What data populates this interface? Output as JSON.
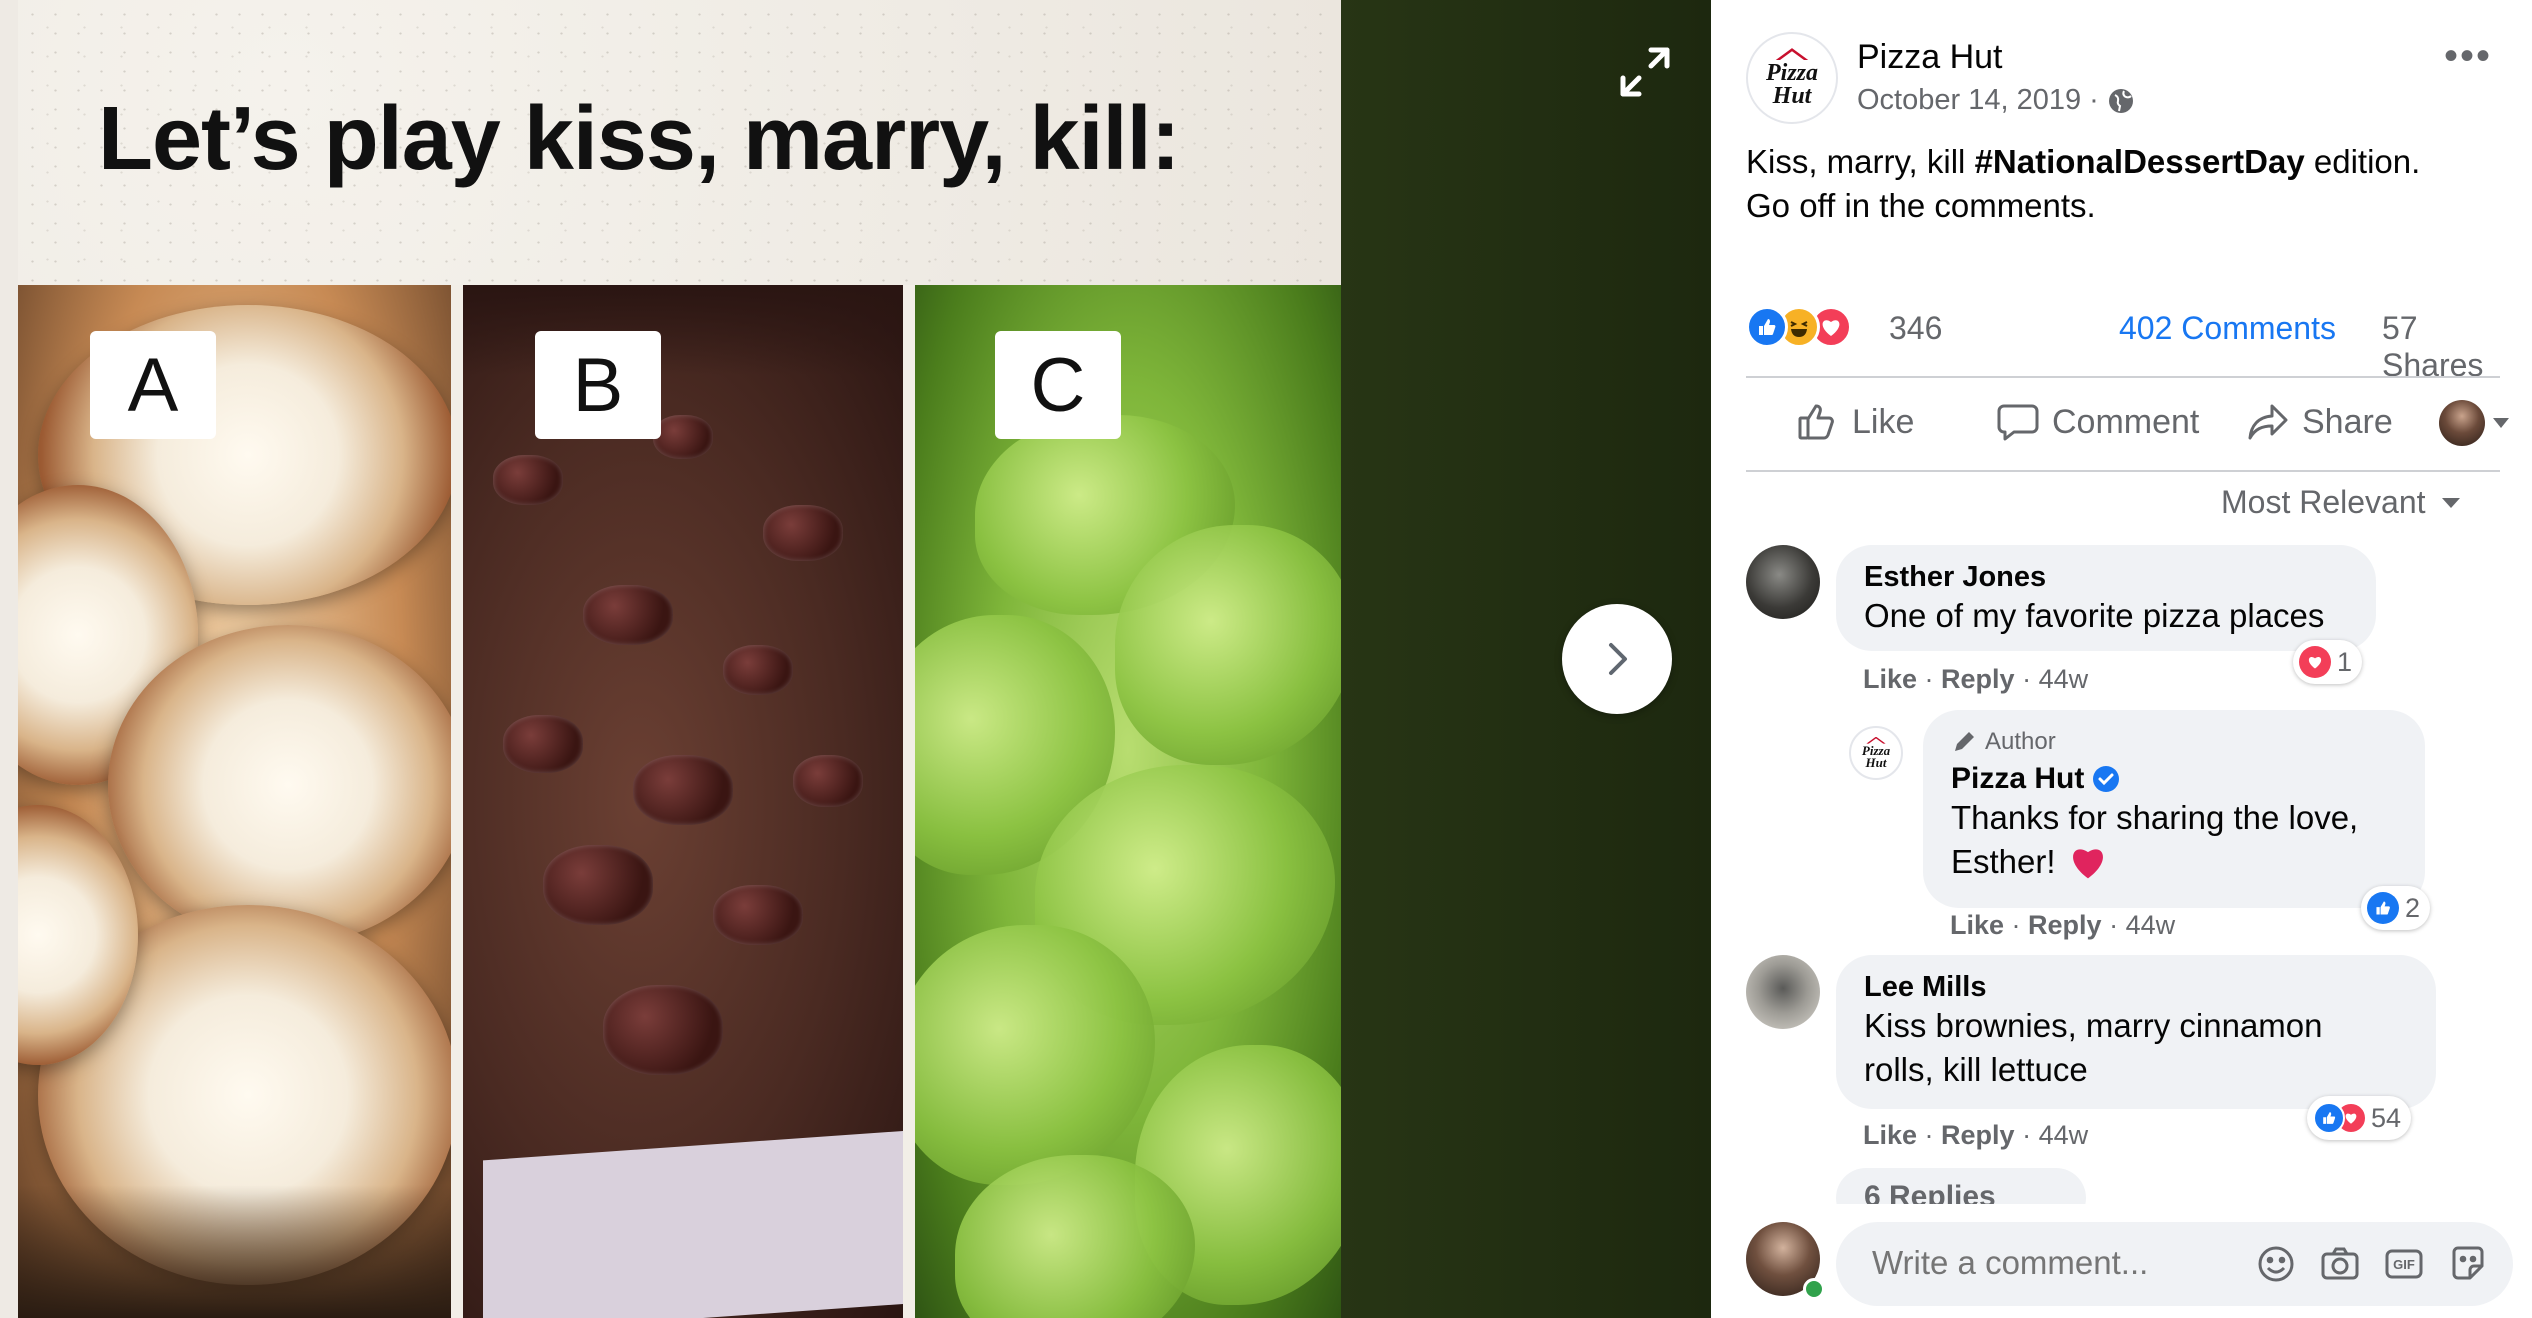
{
  "image": {
    "headline": "Let’s play kiss, marry, kill:",
    "options": [
      "A",
      "B",
      "C"
    ]
  },
  "post": {
    "page_name": "Pizza Hut",
    "date": "October 14, 2019 ·",
    "text_line1_prefix": "Kiss, marry, kill ",
    "hashtag": "#NationalDessertDay",
    "text_line1_suffix": " edition.",
    "text_line2": "Go off in the comments.",
    "reaction_count": "346",
    "comments_count": "402 Comments",
    "shares_count": "57 Shares",
    "more_label": "•••"
  },
  "actions": {
    "like": "Like",
    "comment": "Comment",
    "share": "Share"
  },
  "sort_label": "Most Relevant",
  "logo_text": {
    "line1": "Pizza",
    "line2": "Hut"
  },
  "comments": [
    {
      "name": "Esther Jones",
      "text": "One of my favorite pizza places",
      "like": "Like",
      "reply": "Reply",
      "time": "· 44w",
      "reaction_count": "1"
    },
    {
      "badge": "Author",
      "name": "Pizza Hut",
      "text_line1": "Thanks for sharing the love,",
      "text_line2": "Esther!",
      "like": "Like",
      "reply": "Reply",
      "time": "· 44w",
      "reaction_count": "2"
    },
    {
      "name": "Lee Mills",
      "text_line1": "Kiss brownies, marry cinnamon",
      "text_line2": "rolls, kill lettuce",
      "like": "Like",
      "reply": "Reply",
      "time": "· 44w",
      "reaction_count": "54"
    }
  ],
  "replies_label": "6 Replies",
  "composer": {
    "placeholder": "Write a comment..."
  },
  "colors": {
    "link_blue": "#1877f2",
    "like_blue": "#1877f2",
    "love_red": "#f33e58",
    "haha_yellow": "#f7b125",
    "pizza_red": "#c8102e"
  }
}
